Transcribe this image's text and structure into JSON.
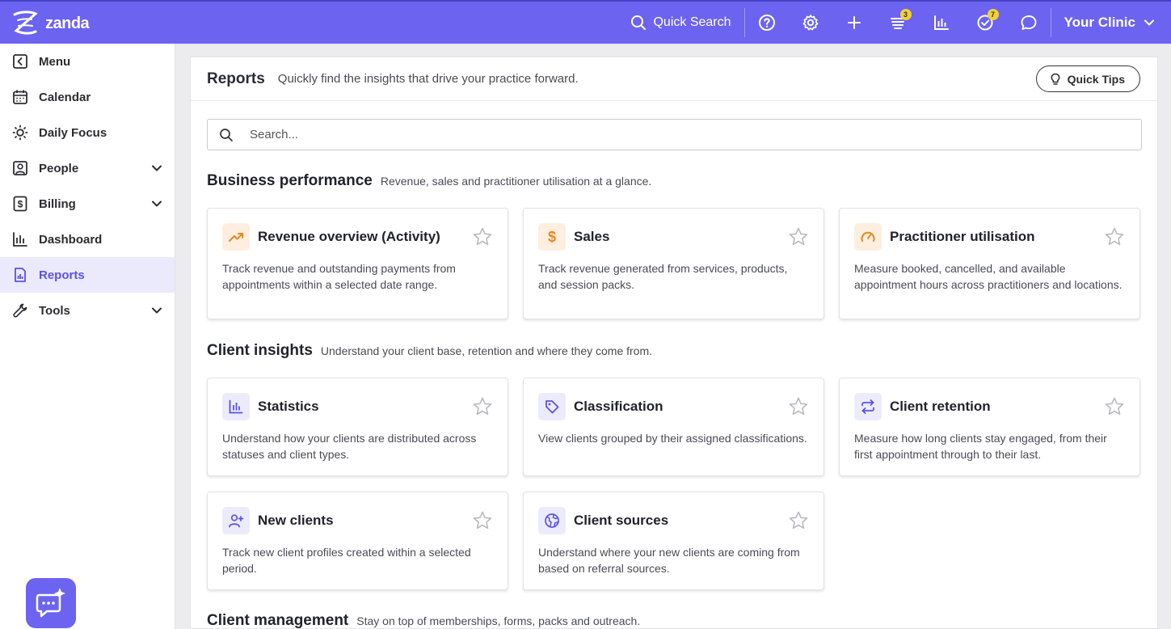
{
  "app": {
    "logo_text": "zanda",
    "clinic": "Your Clinic"
  },
  "topbar": {
    "quick_search": "Quick Search",
    "icons": [
      "help-icon",
      "settings-icon",
      "plus-icon",
      "feed-icon",
      "chart-icon",
      "tasks-icon",
      "chat-icon"
    ],
    "feed_badge": "3",
    "tasks_badge": "7"
  },
  "sidebar": {
    "items": [
      {
        "label": "Menu",
        "icon": "menu-back-icon"
      },
      {
        "label": "Calendar",
        "icon": "calendar-icon"
      },
      {
        "label": "Daily Focus",
        "icon": "sun-icon"
      },
      {
        "label": "People",
        "icon": "people-icon"
      },
      {
        "label": "Billing",
        "icon": "billing-icon"
      },
      {
        "label": "Dashboard",
        "icon": "dashboard-icon"
      },
      {
        "label": "Reports",
        "icon": "reports-icon"
      },
      {
        "label": "Tools",
        "icon": "tools-icon"
      }
    ]
  },
  "header": {
    "title": "Reports",
    "subtitle": "Quickly find the insights that drive your practice forward.",
    "quick_tips": "Quick Tips"
  },
  "search": {
    "placeholder": "Search..."
  },
  "sections": [
    {
      "title": "Business performance",
      "subtitle": "Revenue, sales and practitioner utilisation at a glance.",
      "cards": [
        {
          "title": "Revenue overview (Activity)",
          "desc": "Track revenue and outstanding payments from appointments within a selected date range.",
          "icon": "trend-up-icon"
        },
        {
          "title": "Sales",
          "desc": "Track revenue generated from services, products, and session packs.",
          "icon": "dollar-icon"
        },
        {
          "title": "Practitioner utilisation",
          "desc": "Measure booked, cancelled, and available appointment hours across practitioners and locations.",
          "icon": "gauge-icon"
        }
      ]
    },
    {
      "title": "Client insights",
      "subtitle": "Understand your client base, retention and where they come from.",
      "cards": [
        {
          "title": "Statistics",
          "desc": "Understand how your clients are distributed across statuses and client types.",
          "icon": "bar-chart-icon"
        },
        {
          "title": "Classification",
          "desc": "View clients grouped by their assigned classifications.",
          "icon": "tag-icon"
        },
        {
          "title": "Client retention",
          "desc": "Measure how long clients stay engaged, from their first appointment through to their last.",
          "icon": "repeat-icon"
        },
        {
          "title": "New clients",
          "desc": "Track new client profiles created within a selected period.",
          "icon": "user-plus-icon"
        },
        {
          "title": "Client sources",
          "desc": "Understand where your new clients are coming from based on referral sources.",
          "icon": "globe-icon"
        }
      ]
    },
    {
      "title": "Client management",
      "subtitle": "Stay on top of memberships, forms, packs and outreach."
    }
  ],
  "colors": {
    "brand": "#6c63f0",
    "active_bg": "#ebe9fc",
    "orange": "#e8871e",
    "badge": "#f3d135"
  }
}
